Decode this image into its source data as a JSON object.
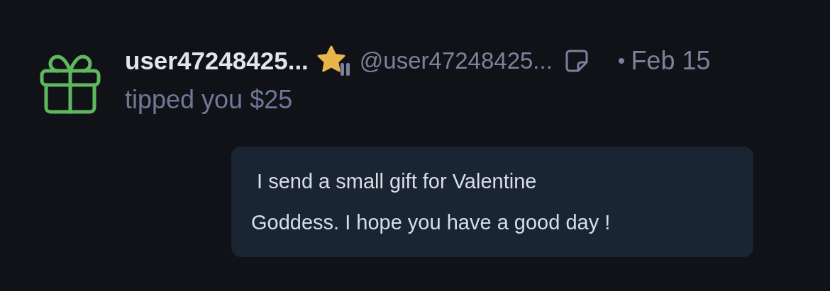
{
  "notification": {
    "kind": "tip",
    "display_name": "user47248425...",
    "verified": true,
    "handle": "@user47248425...",
    "has_note": true,
    "separator": "•",
    "date": "Feb 15",
    "action": "tipped you $25",
    "message": " I send a small gift for Valentine Goddess. I hope you have a good day !"
  }
}
